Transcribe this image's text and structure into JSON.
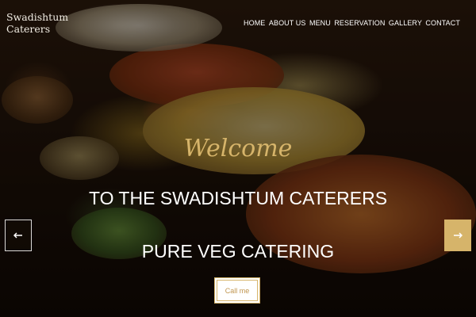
{
  "brand": {
    "line1": "Swadishtum",
    "line2": "Caterers"
  },
  "nav": {
    "items": [
      {
        "label": "HOME"
      },
      {
        "label": "ABOUT US"
      },
      {
        "label": "MENU"
      },
      {
        "label": "RESERVATION"
      },
      {
        "label": "GALLERY"
      },
      {
        "label": "CONTACT"
      }
    ]
  },
  "hero": {
    "welcome": "Welcome",
    "headline": "TO THE SWADISHTUM CATERERS",
    "subheadline": "PURE VEG CATERING",
    "cta_label": "Call me",
    "prev_icon": "arrow-left-icon",
    "next_icon": "arrow-right-icon"
  },
  "colors": {
    "accent": "#d6b46a",
    "text": "#ffffff"
  }
}
